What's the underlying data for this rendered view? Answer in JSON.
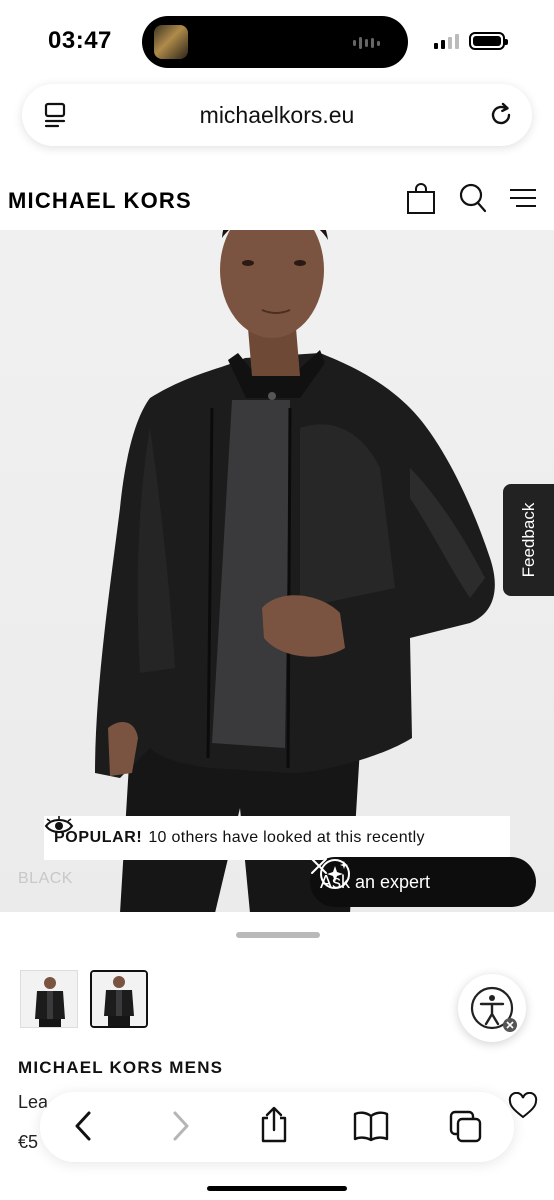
{
  "status_bar": {
    "time": "03:47"
  },
  "browser": {
    "url": "michaelkors.eu"
  },
  "header": {
    "brand": "MICHAEL KORS"
  },
  "hero": {
    "feedback_label": "Feedback",
    "popular_strong": "POPULAR!",
    "popular_rest": "10 others have looked at this recently",
    "color_label": "BLACK",
    "ask_expert_label": "Ask an expert"
  },
  "product": {
    "brand": "MICHAEL KORS MENS",
    "name_partial": "Lea",
    "price_partial": "€5"
  },
  "icons": {
    "tabs": "tabs-icon",
    "reload": "reload-icon",
    "bag": "shopping-bag-icon",
    "search": "search-icon",
    "menu": "hamburger-menu-icon",
    "eye": "eye-icon",
    "sparkle": "sparkle-chat-icon",
    "close": "close-icon",
    "accessibility": "accessibility-icon",
    "heart": "heart-icon",
    "back": "back-icon",
    "forward": "forward-icon",
    "share": "share-icon",
    "bookmarks": "bookmarks-icon",
    "tab_overview": "tab-overview-icon"
  },
  "colors": {
    "ink": "#111111",
    "hero_bg": "#ececec",
    "chip_dark": "#0d0d0d"
  }
}
